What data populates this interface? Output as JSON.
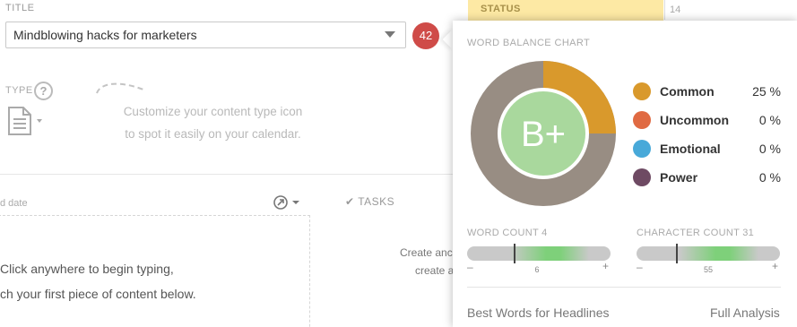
{
  "title_section": {
    "label": "TITLE",
    "value": "Mindblowing hacks for marketers",
    "score": "42"
  },
  "type_section": {
    "label": "TYPE",
    "help": "?",
    "hint_line1": "Customize your content type icon",
    "hint_line2": "to spot it easily on your calendar."
  },
  "content": {
    "date_label": "d date",
    "tasks_label": "TASKS",
    "line1": "Click anywhere to begin typing,",
    "line2": "ch your first piece of content below.",
    "create_line1": "Create anc",
    "create_line2": "create a"
  },
  "status": {
    "label": "STATUS",
    "calendar_day": "14"
  },
  "word_balance": {
    "heading": "WORD BALANCE CHART",
    "grade": "B+",
    "segments": [
      {
        "name": "Common",
        "percent": 25,
        "label": "25 %",
        "color": "#d9992c"
      },
      {
        "name": "Uncommon",
        "percent": 0,
        "label": "0 %",
        "color": "#e06a42"
      },
      {
        "name": "Emotional",
        "percent": 0,
        "label": "0 %",
        "color": "#48a9d9"
      },
      {
        "name": "Power",
        "percent": 0,
        "label": "0 %",
        "color": "#6e4a63"
      }
    ],
    "remainder_color": "#988d83",
    "grade_color": "#a9d89d"
  },
  "word_count": {
    "label": "WORD COUNT 4",
    "value": 4,
    "target": "6",
    "minus": "–",
    "plus": "+"
  },
  "char_count": {
    "label": "CHARACTER COUNT 31",
    "value": 31,
    "target": "55",
    "minus": "–",
    "plus": "+"
  },
  "footer": {
    "best_words": "Best Words for Headlines",
    "full_analysis": "Full Analysis"
  }
}
